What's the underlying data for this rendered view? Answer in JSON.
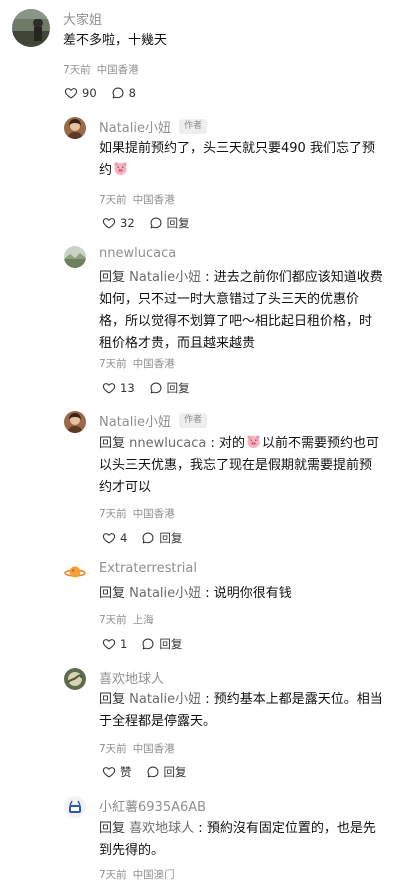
{
  "comments": [
    {
      "name": "大家姐",
      "is_author": false,
      "lines": [
        "差不多啦，十幾天"
      ],
      "time": "7天前",
      "location": "中国香港",
      "likes": "90",
      "second": "8",
      "second_icon": "comment-icon"
    },
    {
      "name": "Natalie小妞",
      "is_author": true,
      "lines": [
        "如果提前预约了，头三天就只要490 我们忘了预",
        "约"
      ],
      "time": "7天前",
      "location": "中国香港",
      "likes": "32",
      "second": "回复",
      "second_icon": "reply-icon"
    },
    {
      "name": "nnewlucaca",
      "is_author": false,
      "reply_prefix": "回复",
      "reply_to": "Natalie小妞",
      "lines": [
        " : 进去之前你们都应该知道收费",
        "如何，只不过一时大意错过了头三天的优惠价",
        "格，所以觉得不划算了吧～相比起日租价格，时",
        "租价格才贵，而且越来越贵"
      ],
      "time": "7天前",
      "location": "中国香港",
      "likes": "13",
      "second": "回复",
      "second_icon": "reply-icon"
    },
    {
      "name": "Natalie小妞",
      "is_author": true,
      "reply_prefix": "回复",
      "reply_to": "nnewlucaca",
      "lines": [
        " : 对的",
        "以前不需要预约也可",
        "以头三天优惠，我忘了现在是假期就需要提前预",
        "约才可以"
      ],
      "time": "7天前",
      "location": "中国香港",
      "likes": "4",
      "second": "回复",
      "second_icon": "reply-icon"
    },
    {
      "name": "Extraterrestrial",
      "is_author": false,
      "reply_prefix": "回复",
      "reply_to": "Natalie小妞",
      "lines": [
        " : 说明你很有钱"
      ],
      "time": "7天前",
      "location": "上海",
      "likes": "1",
      "second": "回复",
      "second_icon": "reply-icon"
    },
    {
      "name": "喜欢地球人",
      "is_author": false,
      "reply_prefix": "回复",
      "reply_to": "Natalie小妞",
      "lines": [
        " : 预约基本上都是露天位。相当",
        "于全程都是停露天。"
      ],
      "time": "7天前",
      "location": "中国香港",
      "likes": "赞",
      "second": "回复",
      "second_icon": "reply-icon"
    },
    {
      "name": "小紅薯6935A6AB",
      "is_author": false,
      "reply_prefix": "回复",
      "reply_to": "喜欢地球人",
      "lines": [
        " : 預約沒有固定位置的，也是先",
        "到先得的。"
      ],
      "time": "7天前",
      "location": "中国澳门"
    }
  ],
  "author_tag": "作者",
  "emoji_name": "pig-face-emoji"
}
